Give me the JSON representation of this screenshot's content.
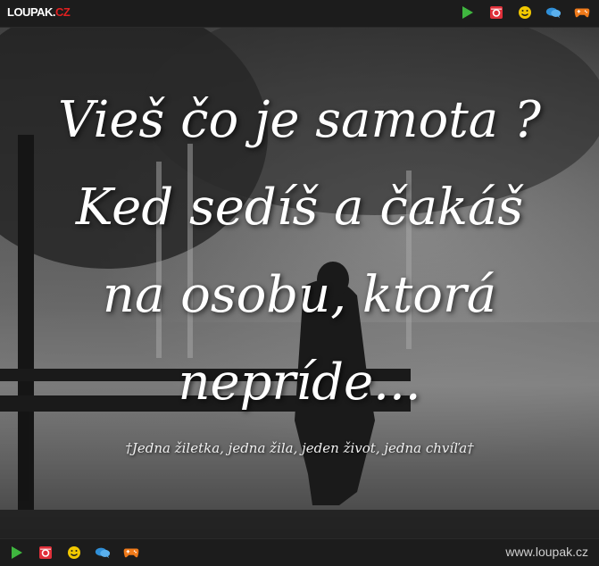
{
  "header": {
    "logo_main": "LOUPAK.",
    "logo_suffix": "CZ",
    "icons": [
      "play-icon",
      "instagram-icon",
      "smiley-icon",
      "chat-icon",
      "gamepad-icon"
    ]
  },
  "colors": {
    "play": "#3fb63f",
    "instagram": "#e0303a",
    "smiley": "#f2c800",
    "chat": "#2f8fd8",
    "gamepad": "#f07a1a",
    "bar_bg": "#1c1c1c"
  },
  "image": {
    "quote_lines": [
      "Vieš čo je samota ?",
      "Ked sedíš  a čakáš",
      "na osobu, ktorá",
      "nepríde..."
    ],
    "caption": "†Jedna žiletka, jedna žila, jeden život, jedna chvíľa†"
  },
  "footer": {
    "site_url": "www.loupak.cz"
  }
}
